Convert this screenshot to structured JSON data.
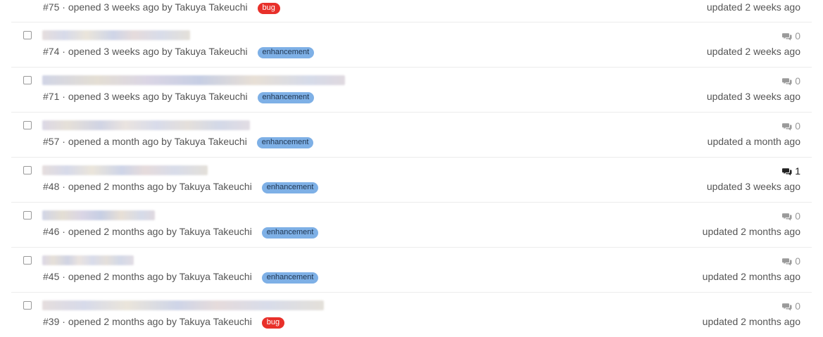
{
  "issues": [
    {
      "number": "#75",
      "opened": "opened 3 weeks ago",
      "by": "by Takuya Takeuchi",
      "label": "bug",
      "label_type": "bug",
      "comments": "",
      "updated": "updated 2 weeks ago",
      "first": true
    },
    {
      "number": "#74",
      "opened": "opened 3 weeks ago",
      "by": "by Takuya Takeuchi",
      "label": "enhancement",
      "label_type": "enh",
      "comments": "0",
      "updated": "updated 2 weeks ago"
    },
    {
      "number": "#71",
      "opened": "opened 3 weeks ago",
      "by": "by Takuya Takeuchi",
      "label": "enhancement",
      "label_type": "enh",
      "comments": "0",
      "updated": "updated 3 weeks ago"
    },
    {
      "number": "#57",
      "opened": "opened a month ago",
      "by": "by Takuya Takeuchi",
      "label": "enhancement",
      "label_type": "enh",
      "comments": "0",
      "updated": "updated a month ago"
    },
    {
      "number": "#48",
      "opened": "opened 2 months ago",
      "by": "by Takuya Takeuchi",
      "label": "enhancement",
      "label_type": "enh",
      "comments": "1",
      "comments_active": true,
      "updated": "updated 3 weeks ago"
    },
    {
      "number": "#46",
      "opened": "opened 2 months ago",
      "by": "by Takuya Takeuchi",
      "label": "enhancement",
      "label_type": "enh",
      "comments": "0",
      "updated": "updated 2 months ago"
    },
    {
      "number": "#45",
      "opened": "opened 2 months ago",
      "by": "by Takuya Takeuchi",
      "label": "enhancement",
      "label_type": "enh",
      "comments": "0",
      "updated": "updated 2 months ago"
    },
    {
      "number": "#39",
      "opened": "opened 2 months ago",
      "by": "by Takuya Takeuchi",
      "label": "bug",
      "label_type": "bug",
      "comments": "0",
      "updated": "updated 2 months ago"
    }
  ],
  "colors": {
    "enhancement": "#7eb0e6",
    "bug": "#e8302a",
    "comment_icon_inactive": "#9a9a9a",
    "comment_icon_active": "#222222"
  },
  "icons": {
    "comment": "comments-icon",
    "checkbox": "checkbox"
  }
}
